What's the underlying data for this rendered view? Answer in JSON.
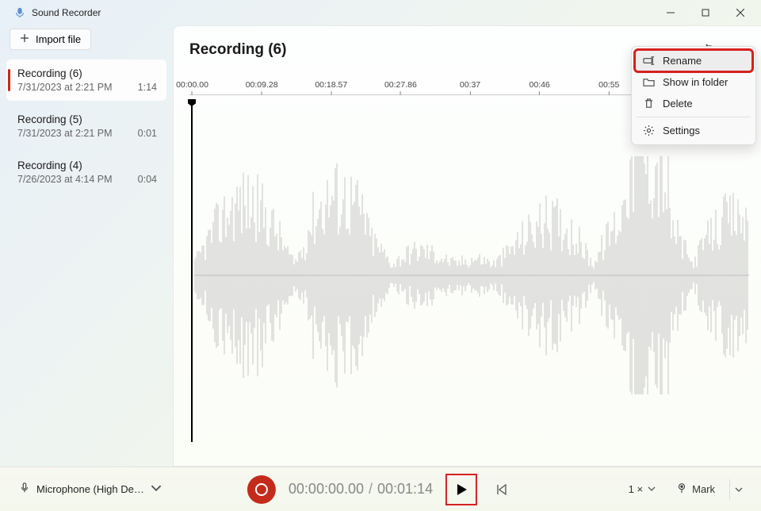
{
  "app": {
    "title": "Sound Recorder"
  },
  "sidebar": {
    "import_label": "Import file",
    "items": [
      {
        "title": "Recording (6)",
        "date": "7/31/2023 at 2:21 PM",
        "duration": "1:14",
        "active": true
      },
      {
        "title": "Recording (5)",
        "date": "7/31/2023 at 2:21 PM",
        "duration": "0:01",
        "active": false
      },
      {
        "title": "Recording (4)",
        "date": "7/26/2023 at 4:14 PM",
        "duration": "0:04",
        "active": false
      }
    ]
  },
  "main": {
    "title": "Recording (6)",
    "timeline_ticks": [
      "00:00.00",
      "00:09.28",
      "00:18.57",
      "00:27.86",
      "00:37",
      "00:46",
      "00:55"
    ]
  },
  "context_menu": {
    "rename": "Rename",
    "show_in_folder": "Show in folder",
    "delete": "Delete",
    "settings": "Settings"
  },
  "bottom": {
    "mic_label": "Microphone (High De…",
    "current_time": "00:00:00.00",
    "total_time": "00:01:14",
    "speed_label": "1 ×",
    "mark_label": "Mark"
  }
}
